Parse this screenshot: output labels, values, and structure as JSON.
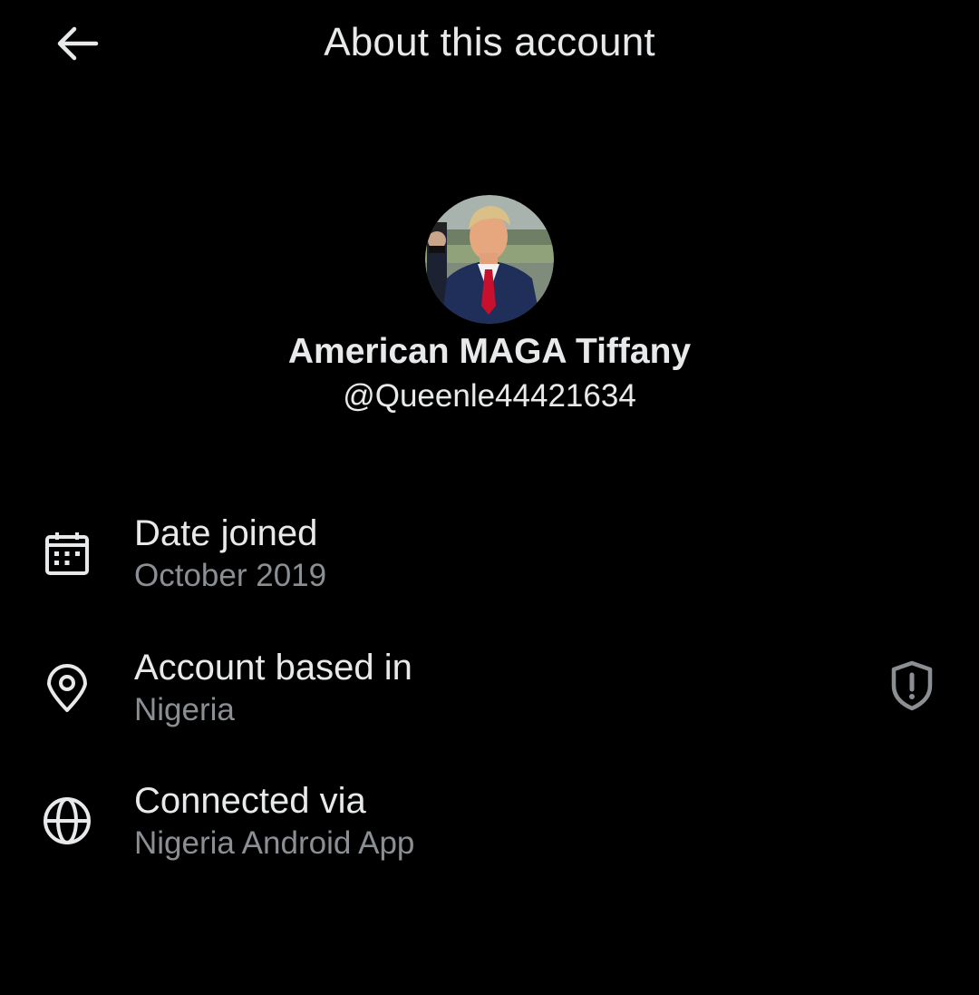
{
  "header": {
    "back_icon": "arrow-left-icon",
    "title": "About this account"
  },
  "profile": {
    "avatar_icon": "profile-photo",
    "display_name": "American MAGA Tiffany",
    "handle": "@Queenle44421634"
  },
  "details": [
    {
      "icon": "calendar-icon",
      "label": "Date joined",
      "value": "October 2019"
    },
    {
      "icon": "location-pin-icon",
      "label": "Account based in",
      "value": "Nigeria",
      "trailing_icon": "shield-alert-icon"
    },
    {
      "icon": "globe-icon",
      "label": "Connected via",
      "value": "Nigeria Android App"
    }
  ],
  "colors": {
    "background": "#000000",
    "primary_text": "#e7e9ea",
    "secondary_text": "#8b8f94"
  }
}
